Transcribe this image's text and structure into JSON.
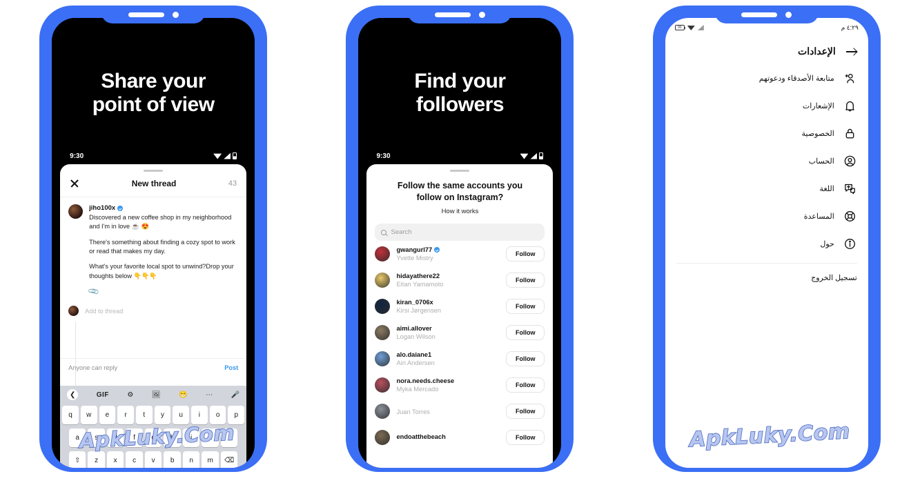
{
  "watermark": {
    "text": "ApkLuky.Com",
    "color": "#b6c6ef",
    "outline": "#4c68c0"
  },
  "theme": {
    "frame_blue": "#3b6ff5",
    "accent_blue": "#3897f0"
  },
  "phone1": {
    "hero_line1": "Share your",
    "hero_line2": "point of view",
    "status": {
      "time": "9:30"
    },
    "header": {
      "close_icon": "close-icon",
      "title": "New thread",
      "count": "43"
    },
    "post": {
      "username": "jiho100x",
      "verified": true,
      "paragraphs": [
        "Discovered a new coffee shop in my neighborhood and I'm in love ☕ 😍",
        "There's something about finding a cozy spot to work or read that makes my day.",
        "What's your favorite local spot to unwind?Drop your thoughts below 👇👇👇"
      ],
      "attach_icon": "paperclip-icon"
    },
    "add_to_thread": "Add to thread",
    "reply_bar": {
      "who_can_reply": "Anyone can reply",
      "post_label": "Post"
    },
    "keyboard": {
      "tools": [
        "back-chevron-icon",
        "GIF",
        "gear-icon",
        "translate-icon",
        "sticker-icon",
        "more-icon",
        "mic-icon"
      ],
      "row1": [
        "q",
        "w",
        "e",
        "r",
        "t",
        "y",
        "u",
        "i",
        "o",
        "p"
      ],
      "row2": [
        "a",
        "s",
        "d",
        "f",
        "g",
        "h",
        "j",
        "k",
        "l"
      ],
      "row3": [
        "⇧",
        "z",
        "x",
        "c",
        "v",
        "b",
        "n",
        "m",
        "⌫"
      ]
    }
  },
  "phone2": {
    "hero_line1": "Find your",
    "hero_line2": "followers",
    "status": {
      "time": "9:30"
    },
    "heading_line1": "Follow the same accounts you",
    "heading_line2": "follow on Instagram?",
    "how_it_works": "How it works",
    "search": {
      "placeholder": "Search",
      "icon": "search-icon"
    },
    "follow_label": "Follow",
    "accounts": [
      {
        "username": "gwangurl77",
        "name": "Yvette Mistry",
        "verified": true,
        "avatar": "#c2313a"
      },
      {
        "username": "hidayathere22",
        "name": "Eitan Yamamoto",
        "verified": false,
        "avatar": "#e8c96a"
      },
      {
        "username": "kiran_0706x",
        "name": "Kirsi Jørgensen",
        "verified": false,
        "avatar": "#10243f"
      },
      {
        "username": "aimi.allover",
        "name": "Logan Wilson",
        "verified": false,
        "avatar": "#8a7a62"
      },
      {
        "username": "alo.daiane1",
        "name": "Airi Andersen",
        "verified": false,
        "avatar": "#6f9ed6"
      },
      {
        "username": "nora.needs.cheese",
        "name": "Myka Mercado",
        "verified": false,
        "avatar": "#b8505e"
      },
      {
        "username": "",
        "name": "Juan Torres",
        "verified": false,
        "avatar": "#8a9099"
      },
      {
        "username": "endoatthebeach",
        "name": "",
        "verified": false,
        "avatar": "#7b6a52"
      }
    ]
  },
  "phone3": {
    "status": {
      "time": "٤:٢٩ م",
      "battery_icon": "battery-icon",
      "wifi_icon": "wifi-icon",
      "signal_icon": "signal-icon"
    },
    "header": {
      "title": "الإعدادات",
      "back_icon": "arrow-right-icon"
    },
    "items": [
      {
        "label": "متابعة الأصدقاء ودعوتهم",
        "icon": "person-add-icon"
      },
      {
        "label": "الإشعارات",
        "icon": "bell-icon"
      },
      {
        "label": "الخصوصية",
        "icon": "lock-icon"
      },
      {
        "label": "الحساب",
        "icon": "account-circle-icon"
      },
      {
        "label": "اللغة",
        "icon": "language-icon"
      },
      {
        "label": "المساعدة",
        "icon": "help-buoy-icon"
      },
      {
        "label": "حول",
        "icon": "info-icon"
      }
    ],
    "logout": "تسجيل الخروج"
  }
}
